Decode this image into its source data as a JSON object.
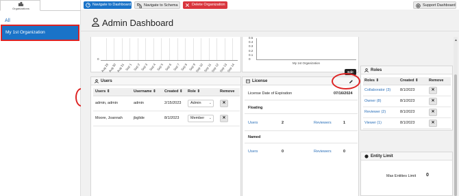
{
  "sidebar": {
    "tab_label": "Organizations",
    "all_label": "All",
    "org_item": "My 1st Organization"
  },
  "toolbar": {
    "dashboard_label": "Navigate to Dashboard",
    "schema_label": "Navigate to Schema",
    "delete_label": "Delete Organization",
    "support_label": "Support Dashboard"
  },
  "header": {
    "title": "Admin Dashboard"
  },
  "chart_data": [
    {
      "type": "bar",
      "title": "",
      "categories": [
        "Aug 29",
        "Aug 30",
        "Aug 31",
        "Sep 1",
        "Sep 2",
        "Sep 3",
        "Sep 4",
        "Sep 5",
        "Sep 6",
        "Sep 7",
        "Sep 8",
        "Sep 9",
        "Sep 10",
        "Sep 11",
        "Sep 12",
        "Sep 13",
        "Sep 14"
      ],
      "values": [
        0,
        0,
        0,
        0,
        0,
        0,
        0,
        0,
        0,
        0,
        0,
        0,
        0,
        0,
        0,
        0,
        0
      ],
      "yticks": [
        "0"
      ]
    },
    {
      "type": "bar",
      "title": "",
      "categories": [
        "My 1st Organization"
      ],
      "values": [
        0
      ],
      "yticks": [
        "0.5",
        "0.4",
        "0.3",
        "0.2",
        "0.1",
        "0"
      ],
      "ylim": [
        0,
        0.5
      ]
    }
  ],
  "users": {
    "title": "Users",
    "columns": [
      "Users",
      "Username",
      "Created",
      "Role",
      "Remove"
    ],
    "rows": [
      {
        "name": "admin, admin",
        "username": "admin",
        "created": "2/15/2023",
        "role": "Admin"
      },
      {
        "name": "Moore, Joannah",
        "username": "jbglide",
        "created": "8/1/2023",
        "role": "Member"
      }
    ],
    "remove_glyph": "✕"
  },
  "license": {
    "title": "License",
    "tooltip": "Edit",
    "expiration_label": "License Date of Expiration",
    "expiration_value": "07/16/2024",
    "floating_label": "Floating",
    "named_label": "Named",
    "floating": {
      "users_label": "Users",
      "users_value": "2",
      "reviewers_label": "Reviewers",
      "reviewers_value": "1"
    },
    "named": {
      "users_label": "Users",
      "users_value": "0",
      "reviewers_label": "Reviewers",
      "reviewers_value": "0"
    }
  },
  "roles": {
    "title": "Roles",
    "columns": [
      "Roles",
      "Created",
      "Remove"
    ],
    "rows": [
      {
        "role": "Collaborator (3)",
        "created": "8/1/2023"
      },
      {
        "role": "Owner (8)",
        "created": "8/1/2023"
      },
      {
        "role": "Reviewer (2)",
        "created": "8/1/2023"
      },
      {
        "role": "Viewer (1)",
        "created": "8/1/2023"
      }
    ]
  },
  "entity": {
    "title": "Entity Limit",
    "label": "Max Entities Limit",
    "value": "0"
  },
  "colors": {
    "primary": "#1a73c8",
    "danger": "#d9363e",
    "highlight": "#dd2222"
  }
}
